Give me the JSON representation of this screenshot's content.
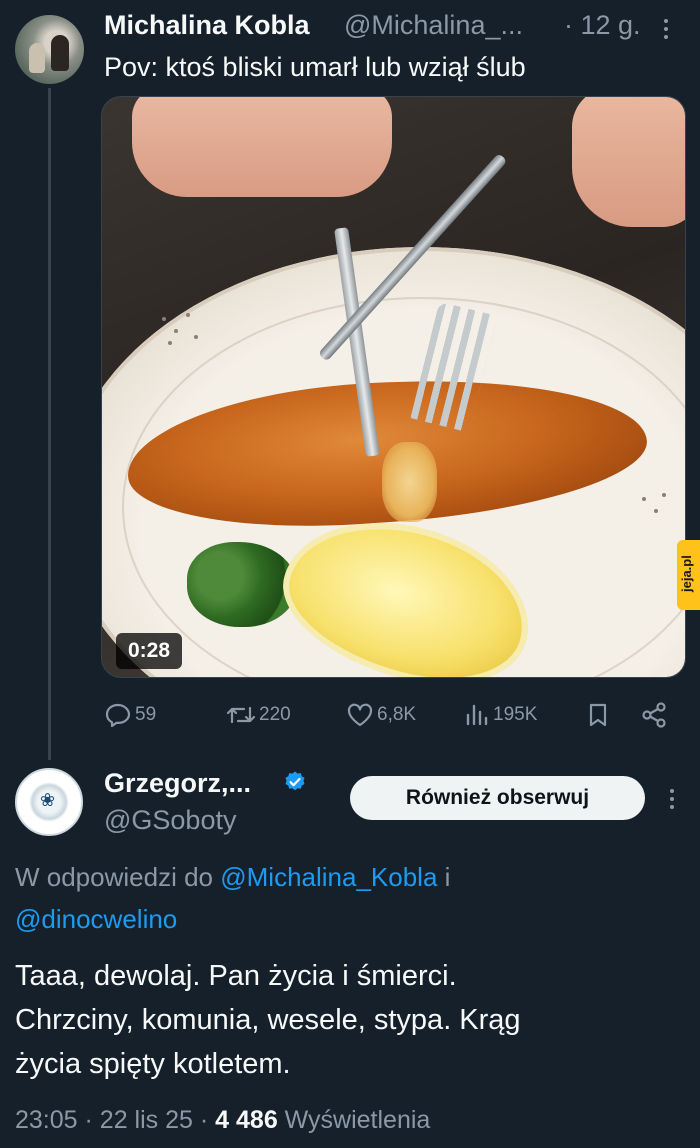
{
  "tweet": {
    "author_name": "Michalina Kobla",
    "author_handle": "@Michalina_...",
    "time": "· 12 g.",
    "text": "Pov: ktoś bliski umarł lub wziął ślub",
    "media": {
      "duration": "0:28",
      "watermark": "jeja.pl"
    },
    "actions": {
      "replies": "59",
      "retweets": "220",
      "likes": "6,8K",
      "views": "195K"
    }
  },
  "reply": {
    "author_name": "Grzegorz,...",
    "author_handle": "@GSoboty",
    "follow_label": "Również obserwuj",
    "reply_prefix": "W odpowiedzi do",
    "reply_user1": "@Michalina_Kobla",
    "reply_and": "i",
    "reply_user2": "@dinocwelino",
    "text_line1": "Taaa, dewolaj. Pan życia i śmierci.",
    "text_line2": "Chrzciny, komunia, wesele, stypa. Krąg",
    "text_line3": "życia spięty kotletem.",
    "time": "23:05",
    "date": "22 lis 25",
    "views_count": "4 486",
    "views_label": "Wyświetlenia"
  },
  "colors": {
    "background": "#15202b",
    "accent": "#1d9bf0",
    "muted": "#8b98a5",
    "text": "#f7f9f9"
  }
}
